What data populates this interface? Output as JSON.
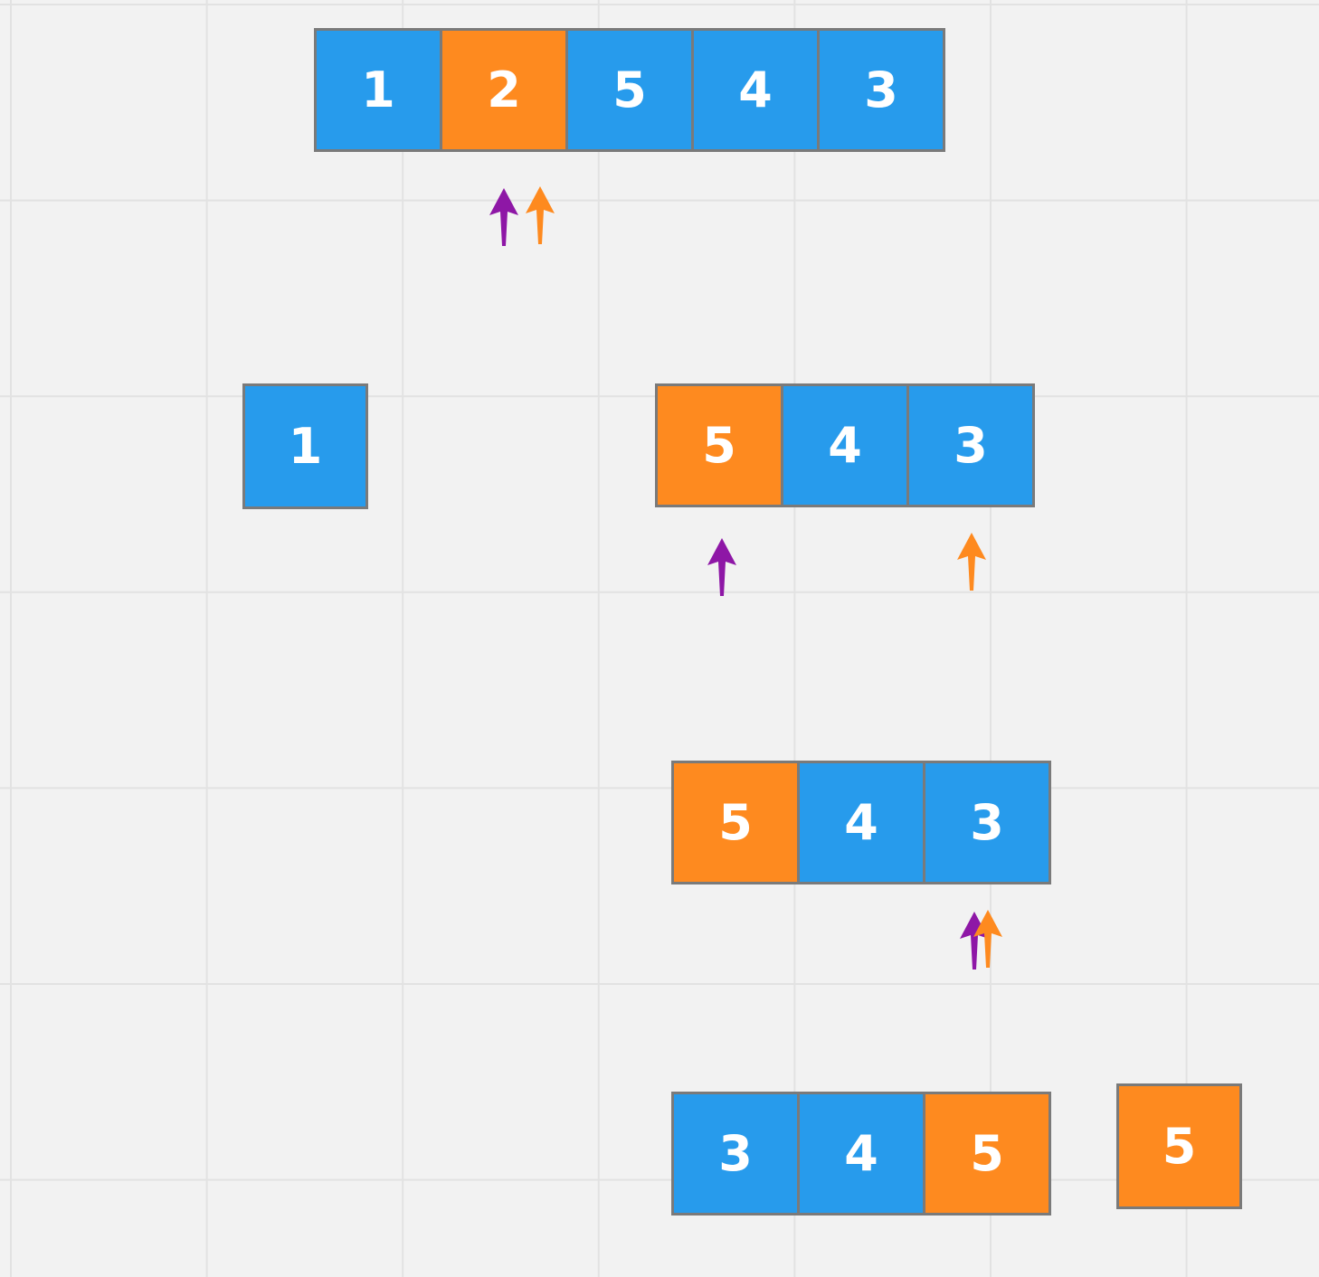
{
  "colors": {
    "background": "#f2f2f2",
    "grid_line": "#e2e2e2",
    "cell_blue": "#279bec",
    "cell_orange": "#fe8a1f",
    "cell_border": "#7a7a7a",
    "pointer_purple": "#8e17a6",
    "pointer_orange": "#fe8a1f"
  },
  "stage1": {
    "cells": [
      {
        "value": "1",
        "color": "blue"
      },
      {
        "value": "2",
        "color": "orange"
      },
      {
        "value": "5",
        "color": "blue"
      },
      {
        "value": "4",
        "color": "blue"
      },
      {
        "value": "3",
        "color": "blue"
      }
    ],
    "pointers": [
      "purple-arrow-icon",
      "orange-arrow-icon"
    ]
  },
  "stage2": {
    "left_block": {
      "value": "1",
      "color": "blue"
    },
    "cells": [
      {
        "value": "5",
        "color": "orange"
      },
      {
        "value": "4",
        "color": "blue"
      },
      {
        "value": "3",
        "color": "blue"
      }
    ],
    "pointers": [
      "purple-arrow-icon",
      "orange-arrow-icon"
    ]
  },
  "stage3": {
    "cells": [
      {
        "value": "5",
        "color": "orange"
      },
      {
        "value": "4",
        "color": "blue"
      },
      {
        "value": "3",
        "color": "blue"
      }
    ],
    "pointers": [
      "purple-arrow-icon",
      "orange-arrow-icon"
    ]
  },
  "stage4": {
    "cells": [
      {
        "value": "3",
        "color": "blue"
      },
      {
        "value": "4",
        "color": "blue"
      },
      {
        "value": "5",
        "color": "orange"
      }
    ],
    "right_block": {
      "value": "5",
      "color": "orange"
    }
  }
}
